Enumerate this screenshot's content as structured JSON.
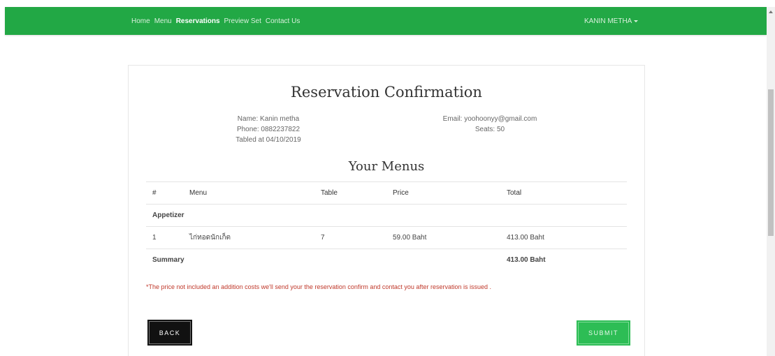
{
  "nav": {
    "links": [
      {
        "label": "Home",
        "active": false
      },
      {
        "label": "Menu",
        "active": false
      },
      {
        "label": "Reservations",
        "active": true
      },
      {
        "label": "Preview Set",
        "active": false
      },
      {
        "label": "Contact Us",
        "active": false
      }
    ],
    "user": "KANIN METHA"
  },
  "reservation": {
    "title": "Reservation Confirmation",
    "name": "Name: Kanin metha",
    "phone": "Phone: 0882237822",
    "tabled_at": "Tabled at 04/10/2019",
    "email": "Email: yoohoonyy@gmail.com",
    "seats": "Seats: 50"
  },
  "menus": {
    "title": "Your Menus",
    "headers": [
      "#",
      "Menu",
      "Table",
      "Price",
      "Total"
    ],
    "category": "Appetizer",
    "rows": [
      {
        "no": "1",
        "menu": "ไก่ทอดนักเก็ต",
        "table": "7",
        "price": "59.00 Baht",
        "total": "413.00 Baht"
      }
    ],
    "summary_label": "Summary",
    "summary_total": "413.00 Baht"
  },
  "note": "*The price not included an addition costs we'll send your the reservation confirm and contact you after reservation is issued .",
  "buttons": {
    "back": "BACK",
    "submit": "SUBMIT"
  },
  "colors": {
    "navbar": "#22a845",
    "submit": "#2dbd55",
    "back": "#111111",
    "note": "#c0392b"
  }
}
